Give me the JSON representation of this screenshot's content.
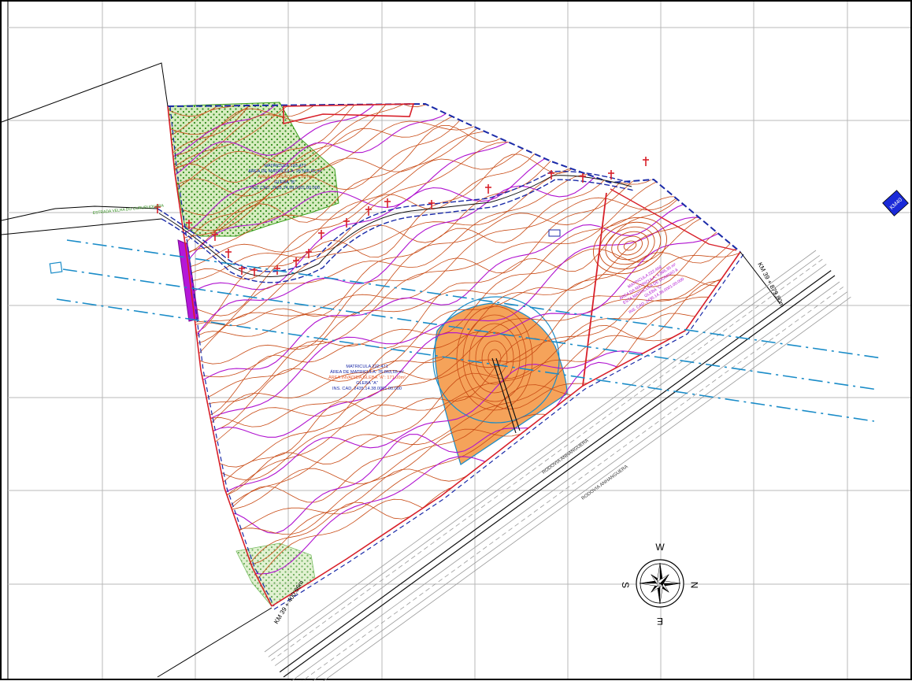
{
  "map": {
    "parcels": [
      {
        "matricula": "MATRICULA 193.472",
        "area": "ÁREA DE MATRICULA: 25.566,62 m²",
        "invasion": "ÁREA INVASÃO: 407,56 m²",
        "gleba": "GLEBA \"B\"",
        "cadastro": "INS. CAD. 2435.14.98.0001.00.000"
      },
      {
        "matricula": "MATRICULA 222.471",
        "area": "ÁREA DE MATRICULA: 76.863,65 m²",
        "invasion": "ÁREA INVADIDA GLEBA \"A\": 171,00m²",
        "gleba": "GLEBA \"A\"",
        "cadastro": "INS. CAD. 2435.14.38.0001.00.000"
      },
      {
        "matricula": "MATRICULA 222.468",
        "area": "ÁREA DA MATRICULA: 5.866,35 m²",
        "owner": "ESTA MATRICULA DE DOMINIO A",
        "gleba": "GLEBA \"C\"",
        "cadastro": "INS. CAD. 2435.14.38.0001.00.000"
      }
    ],
    "road": {
      "name": "ESTRADA VELHA DO CURURUQUARA",
      "highway_top": "RODOVIA ANHANGUERA",
      "highway_bottom": "RODOVIA ANHANGUERA"
    },
    "km_marks": [
      "KM 39 + 879,80m",
      "KM 39 + 400,66m"
    ],
    "km_sign": "KM40",
    "compass": {
      "n": "N",
      "s": "S",
      "e": "E",
      "w": "W"
    }
  },
  "colors": {
    "contour_orange": "#c84a14",
    "contour_magenta": "#b012d0",
    "boundary_red": "#d8202a",
    "boundary_blue": "#1a2aa8",
    "utility_cyan": "#1a8cc8",
    "vegetation_green": "#3ca01c",
    "orange_fill": "#f5a35a",
    "magenta_fill": "#b418d8",
    "grid": "#b8b8b8"
  }
}
